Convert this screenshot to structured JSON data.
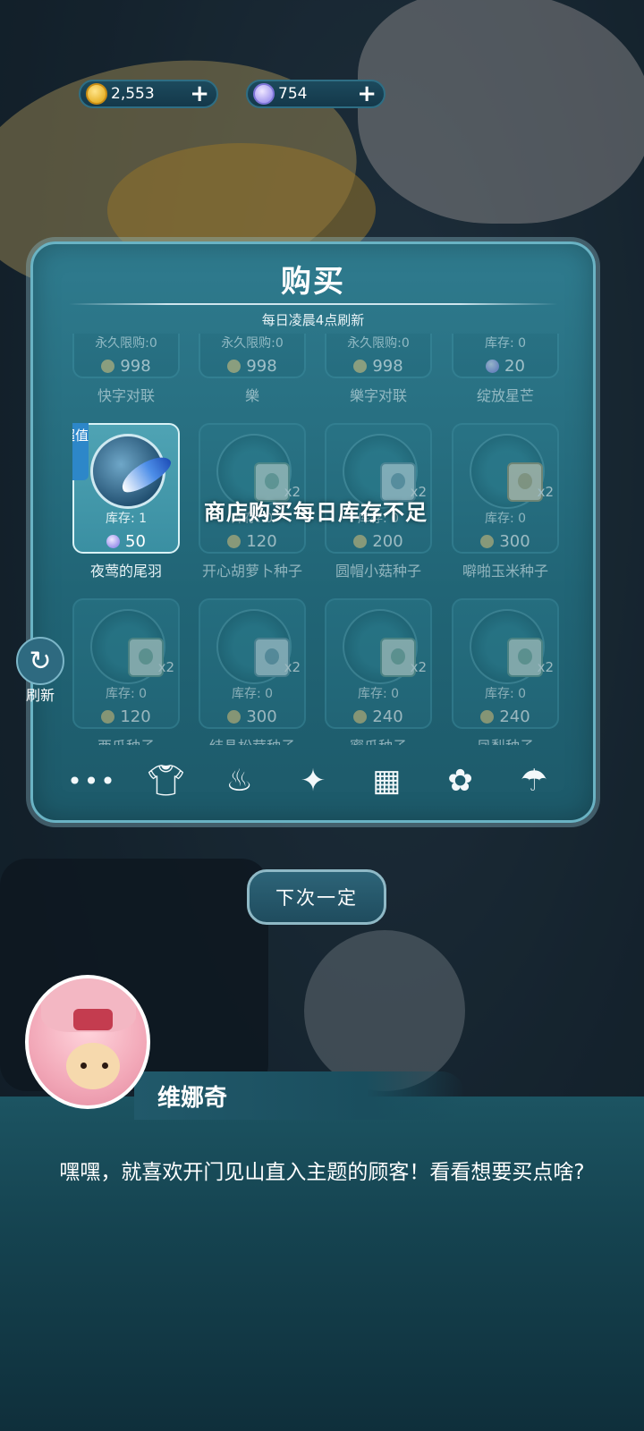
{
  "currency": {
    "coins": "2,553",
    "moons": "754",
    "plus": "+"
  },
  "shop": {
    "title": "购买",
    "subtitle": "每日凌晨4点刷新",
    "toast": "商店购买每日库存不足",
    "badge": "超值",
    "row0": [
      {
        "stock": "永久限购:0",
        "price": "998",
        "currency": "coin",
        "name": "快字对联"
      },
      {
        "stock": "永久限购:0",
        "price": "998",
        "currency": "coin",
        "name": "樂"
      },
      {
        "stock": "永久限购:0",
        "price": "998",
        "currency": "coin",
        "name": "樂字对联"
      },
      {
        "stock": "库存: 0",
        "price": "20",
        "currency": "moon",
        "name": "绽放星芒"
      }
    ],
    "row1": [
      {
        "stock": "库存: 1",
        "price": "50",
        "currency": "moon",
        "name": "夜莺的尾羽",
        "qty": ""
      },
      {
        "stock": "库存: 0",
        "price": "120",
        "currency": "coin",
        "name": "开心胡萝卜种子",
        "qty": "x2"
      },
      {
        "stock": "库存: 0",
        "price": "200",
        "currency": "coin",
        "name": "圆帽小菇种子",
        "qty": "x2"
      },
      {
        "stock": "库存: 0",
        "price": "300",
        "currency": "coin",
        "name": "噼啪玉米种子",
        "qty": "x2"
      }
    ],
    "row2": [
      {
        "stock": "库存: 0",
        "price": "120",
        "currency": "coin",
        "name": "西瓜种子",
        "qty": "x2"
      },
      {
        "stock": "库存: 0",
        "price": "300",
        "currency": "coin",
        "name": "结晶松茸种子",
        "qty": "x2"
      },
      {
        "stock": "库存: 0",
        "price": "240",
        "currency": "coin",
        "name": "蜜瓜种子",
        "qty": "x2"
      },
      {
        "stock": "库存: 0",
        "price": "240",
        "currency": "coin",
        "name": "凤梨种子",
        "qty": "x2"
      }
    ],
    "tabs": [
      "more-tab",
      "clothing-tab",
      "food-tab",
      "bag-tab",
      "furniture-tab",
      "flower-tab",
      "umbrella-tab"
    ]
  },
  "refresh_label": "刷新",
  "next_button": "下次一定",
  "dialog": {
    "speaker": "维娜奇",
    "text": "嘿嘿，就喜欢开门见山直入主题的顾客！看看想要买点啥?"
  }
}
